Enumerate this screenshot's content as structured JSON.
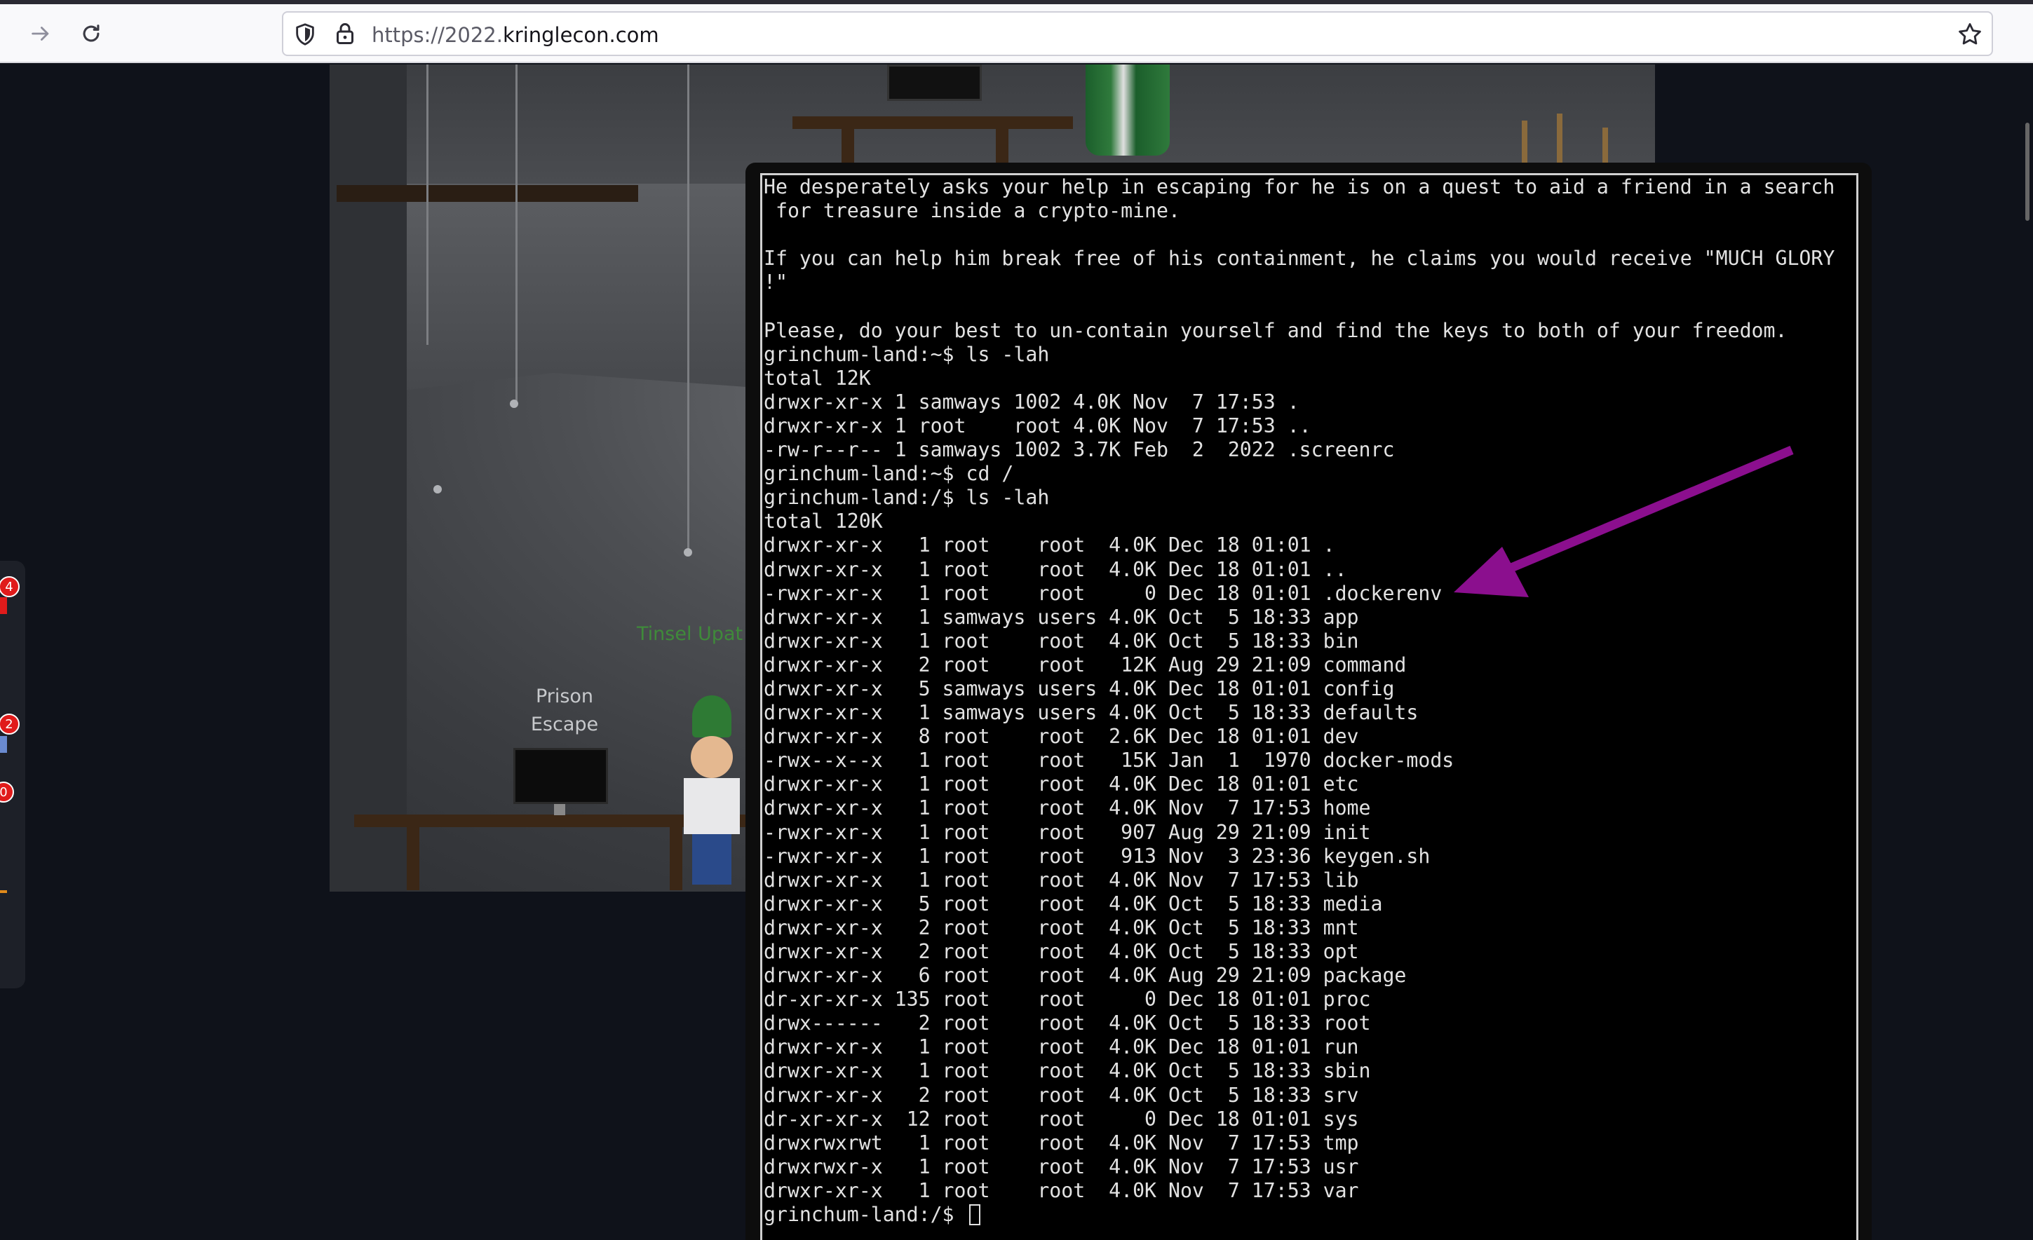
{
  "browser": {
    "url_scheme": "https://",
    "url_host_prefix": "2022.",
    "url_host": "kringlecon.com",
    "icons": [
      "arrow-forward-icon",
      "reload-icon",
      "shield-icon",
      "lock-icon",
      "star-icon"
    ]
  },
  "game": {
    "prison_label_line1": "Prison",
    "prison_label_line2": "Escape",
    "tinsel_label": "Tinsel Upat",
    "sidebar_badges": [
      "4",
      "2",
      "0"
    ],
    "colors": {
      "tinsel": "#3f8a3a",
      "badge": "#e01b1b",
      "arrow": "#8b0f8e"
    }
  },
  "terminal": {
    "lines": [
      "He desperately asks your help in escaping for he is on a quest to aid a friend in a search",
      " for treasure inside a crypto-mine.",
      "",
      "If you can help him break free of his containment, he claims you would receive \"MUCH GLORY",
      "!\"",
      "",
      "Please, do your best to un-contain yourself and find the keys to both of your freedom.",
      "grinchum-land:~$ ls -lah",
      "total 12K",
      "drwxr-xr-x 1 samways 1002 4.0K Nov  7 17:53 .",
      "drwxr-xr-x 1 root    root 4.0K Nov  7 17:53 ..",
      "-rw-r--r-- 1 samways 1002 3.7K Feb  2  2022 .screenrc",
      "grinchum-land:~$ cd /",
      "grinchum-land:/$ ls -lah",
      "total 120K",
      "drwxr-xr-x   1 root    root  4.0K Dec 18 01:01 .",
      "drwxr-xr-x   1 root    root  4.0K Dec 18 01:01 ..",
      "-rwxr-xr-x   1 root    root     0 Dec 18 01:01 .dockerenv",
      "drwxr-xr-x   1 samways users 4.0K Oct  5 18:33 app",
      "drwxr-xr-x   1 root    root  4.0K Oct  5 18:33 bin",
      "drwxr-xr-x   2 root    root   12K Aug 29 21:09 command",
      "drwxr-xr-x   5 samways users 4.0K Dec 18 01:01 config",
      "drwxr-xr-x   1 samways users 4.0K Oct  5 18:33 defaults",
      "drwxr-xr-x   8 root    root  2.6K Dec 18 01:01 dev",
      "-rwx--x--x   1 root    root   15K Jan  1  1970 docker-mods",
      "drwxr-xr-x   1 root    root  4.0K Dec 18 01:01 etc",
      "drwxr-xr-x   1 root    root  4.0K Nov  7 17:53 home",
      "-rwxr-xr-x   1 root    root   907 Aug 29 21:09 init",
      "-rwxr-xr-x   1 root    root   913 Nov  3 23:36 keygen.sh",
      "drwxr-xr-x   1 root    root  4.0K Nov  7 17:53 lib",
      "drwxr-xr-x   5 root    root  4.0K Oct  5 18:33 media",
      "drwxr-xr-x   2 root    root  4.0K Oct  5 18:33 mnt",
      "drwxr-xr-x   2 root    root  4.0K Oct  5 18:33 opt",
      "drwxr-xr-x   6 root    root  4.0K Aug 29 21:09 package",
      "dr-xr-xr-x 135 root    root     0 Dec 18 01:01 proc",
      "drwx------   2 root    root  4.0K Oct  5 18:33 root",
      "drwxr-xr-x   1 root    root  4.0K Dec 18 01:01 run",
      "drwxr-xr-x   1 root    root  4.0K Oct  5 18:33 sbin",
      "drwxr-xr-x   2 root    root  4.0K Oct  5 18:33 srv",
      "dr-xr-xr-x  12 root    root     0 Dec 18 01:01 sys",
      "drwxrwxrwt   1 root    root  4.0K Nov  7 17:53 tmp",
      "drwxrwxr-x   1 root    root  4.0K Nov  7 17:53 usr",
      "drwxr-xr-x   1 root    root  4.0K Nov  7 17:53 var"
    ],
    "prompt": "grinchum-land:/$ "
  }
}
